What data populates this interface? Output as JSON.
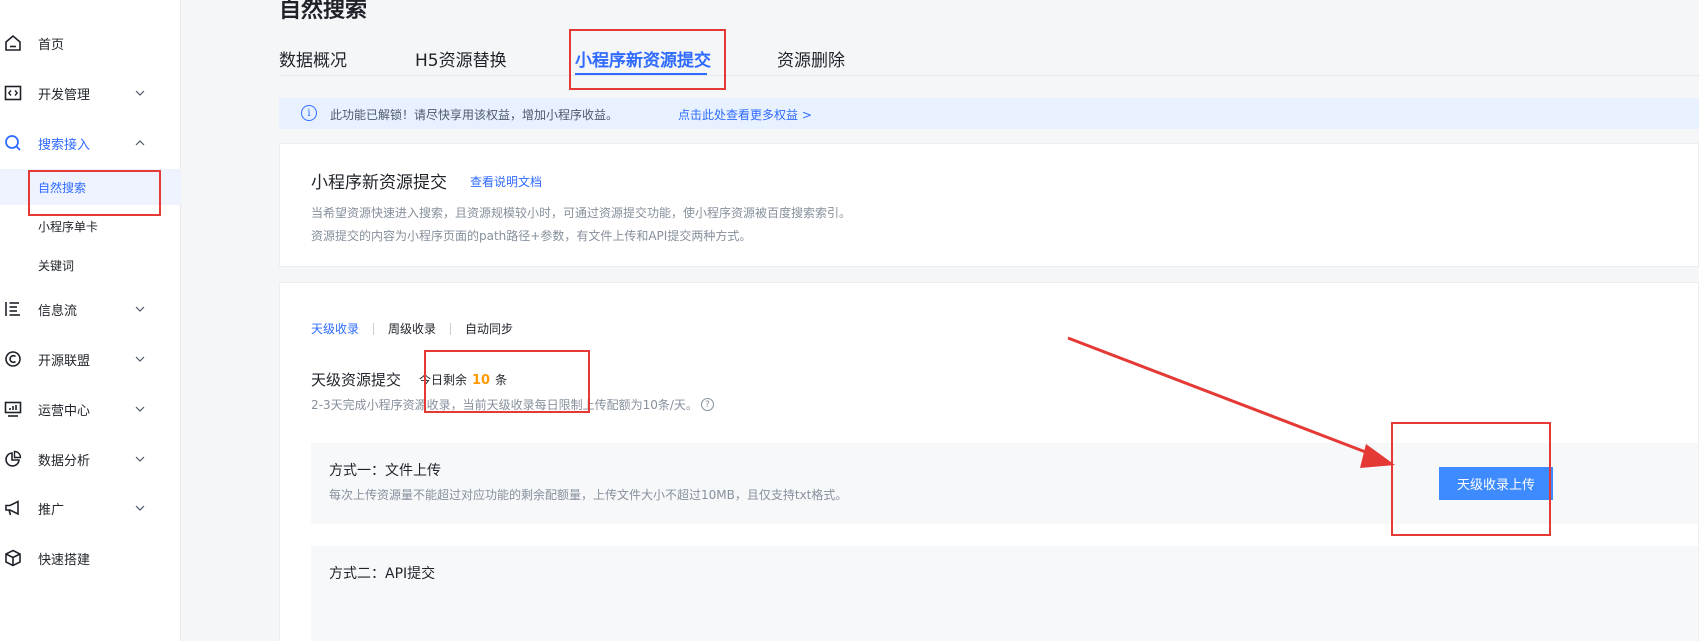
{
  "sidebar": {
    "items": [
      {
        "label": "首页",
        "icon": "home-icon",
        "expandable": false
      },
      {
        "label": "开发管理",
        "icon": "code-icon",
        "expandable": true
      },
      {
        "label": "搜索接入",
        "icon": "search-icon",
        "expandable": true,
        "expanded": true,
        "active": true
      },
      {
        "label": "信息流",
        "icon": "feed-icon",
        "expandable": true
      },
      {
        "label": "开源联盟",
        "icon": "copyright-icon",
        "expandable": true
      },
      {
        "label": "运营中心",
        "icon": "monitor-icon",
        "expandable": true
      },
      {
        "label": "数据分析",
        "icon": "pie-chart-icon",
        "expandable": true
      },
      {
        "label": "推广",
        "icon": "megaphone-icon",
        "expandable": true
      },
      {
        "label": "快速搭建",
        "icon": "cube-icon",
        "expandable": false
      }
    ],
    "subitems": [
      {
        "label": "自然搜索",
        "selected": true
      },
      {
        "label": "小程序单卡",
        "selected": false
      },
      {
        "label": "关键词",
        "selected": false
      }
    ]
  },
  "page": {
    "title": "自然搜索"
  },
  "tabs": [
    {
      "label": "数据概况",
      "active": false
    },
    {
      "label": "H5资源替换",
      "active": false
    },
    {
      "label": "小程序新资源提交",
      "active": true
    },
    {
      "label": "资源删除",
      "active": false
    }
  ],
  "notice": {
    "text": "此功能已解锁！请尽快享用该权益，增加小程序收益。",
    "link": "点击此处查看更多权益 >"
  },
  "intro": {
    "title": "小程序新资源提交",
    "doc_link": "查看说明文档",
    "desc1": "当希望资源快速进入搜索，且资源规模较小时，可通过资源提交功能，使小程序资源被百度搜索索引。",
    "desc2": "资源提交的内容为小程序页面的path路径+参数，有文件上传和API提交两种方式。"
  },
  "submit": {
    "subtabs": [
      {
        "label": "天级收录",
        "active": true
      },
      {
        "label": "周级收录",
        "active": false
      },
      {
        "label": "自动同步",
        "active": false
      }
    ],
    "section_title": "天级资源提交",
    "quota_prefix": "今日剩余",
    "quota_value": "10",
    "quota_suffix": "条",
    "section_desc": "2-3天完成小程序资源收录，当前天级收录每日限制上传配额为10条/天。",
    "help_icon_glyph": "?",
    "method1": {
      "title": "方式一：文件上传",
      "desc": "每次上传资源量不能超过对应功能的剩余配额量，上传文件大小不超过10MB，且仅支持txt格式。",
      "button": "天级收录上传"
    },
    "method2": {
      "title": "方式二：API提交"
    }
  },
  "colors": {
    "accent": "#2f6bff",
    "button": "#3d8bff",
    "quota": "#ff9a00",
    "annotation": "#e53935"
  }
}
